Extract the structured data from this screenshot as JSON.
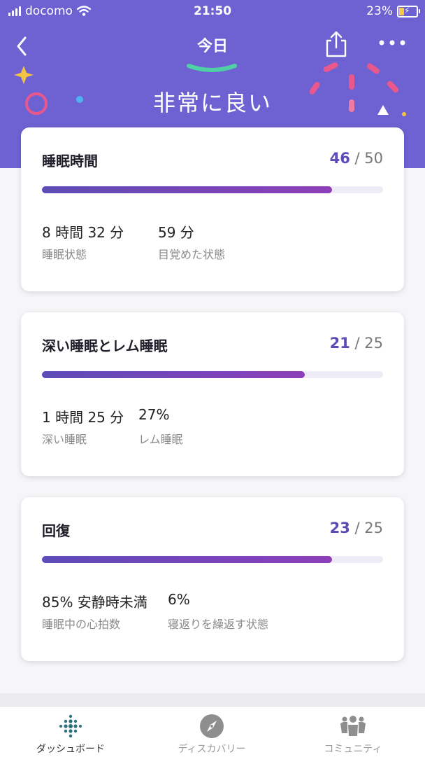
{
  "status_bar": {
    "carrier": "docomo",
    "time": "21:50",
    "battery": "23%"
  },
  "nav": {
    "title": "今日"
  },
  "hero": {
    "rating": "非常に良い"
  },
  "cards": [
    {
      "title": "睡眠時間",
      "score": "46",
      "max": "/ 50",
      "progress": 0.85,
      "stats": [
        {
          "value": "8 時間 32 分",
          "label": "睡眠状態"
        },
        {
          "value": "59 分",
          "label": "目覚めた状態"
        }
      ]
    },
    {
      "title": "深い睡眠とレム睡眠",
      "score": "21",
      "max": "/ 25",
      "progress": 0.77,
      "stats": [
        {
          "value": "1 時間 25 分",
          "label": "深い睡眠"
        },
        {
          "value": "27%",
          "label": "レム睡眠"
        }
      ]
    },
    {
      "title": "回復",
      "score": "23",
      "max": "/ 25",
      "progress": 0.85,
      "stats": [
        {
          "value": "85% 安静時未満",
          "label": "睡眠中の心拍数"
        },
        {
          "value": "6%",
          "label": "寝返りを繰返す状態"
        }
      ]
    }
  ],
  "tabbar": {
    "tabs": [
      {
        "label": "ダッシュボード",
        "icon": "dots-grid-icon",
        "active": true
      },
      {
        "label": "ディスカバリー",
        "icon": "compass-icon",
        "active": false
      },
      {
        "label": "コミュニティ",
        "icon": "community-icon",
        "active": false
      }
    ]
  },
  "colors": {
    "hero": "#6e62d2",
    "accent": "#5a4bb8",
    "bar_start": "#5d4cb8",
    "bar_end": "#8d3fb9"
  }
}
